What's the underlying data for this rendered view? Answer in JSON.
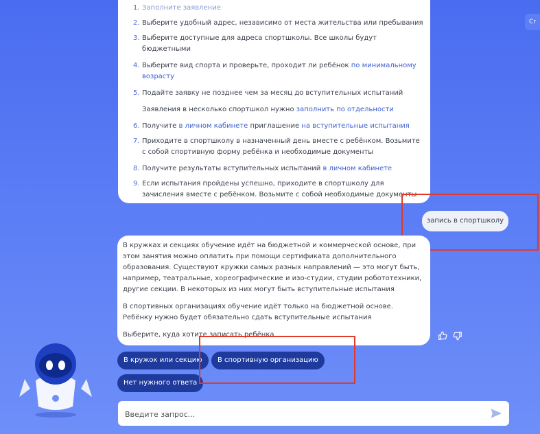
{
  "instructions": {
    "step1_partial": "Заполните заявление",
    "steps": [
      {
        "num": "2.",
        "text": "Выберите удобный адрес, независимо от места жительства или пребывания"
      },
      {
        "num": "3.",
        "text": "Выберите доступные для адреса спортшколы. Все школы будут бюджетными"
      },
      {
        "num": "4.",
        "text_before": "Выберите вид спорта и проверьте, проходит ли ребёнок ",
        "link": "по минимальному возрасту"
      },
      {
        "num": "5.",
        "text": "Подайте заявку не позднее чем за месяц до вступительных испытаний"
      },
      {
        "num": "",
        "text_before": "Заявления в несколько спортшкол нужно ",
        "link": "заполнить по отдельности"
      },
      {
        "num": "6.",
        "text_before": "Получите ",
        "link": "в личном кабинете",
        "text_middle": " приглашение ",
        "link2": "на вступительные испытания"
      },
      {
        "num": "7.",
        "text": "Приходите в спортшколу в назначенный день вместе с ребёнком. Возьмите с собой спортивную форму ребёнка и необходимые документы"
      },
      {
        "num": "8.",
        "text_before": "Получите результаты вступительных испытаний ",
        "link": "в личном кабинете"
      },
      {
        "num": "9.",
        "text": "Если испытания пройдены успешно, приходите в спортшколу для зачисления вместе с ребёнком. Возьмите с собой необходимые документы"
      }
    ]
  },
  "top_right_chip": "Cr",
  "user_message": "запись в спортшколу",
  "bot_message": {
    "p1": "В кружках и секциях обучение идёт на бюджетной и коммерческой основе, при этом занятия можно оплатить при помощи сертификата дополнительного образования. Существуют кружки самых разных направлений — это могут быть, например, театральные, хореографические и изо-студии, студии робототехники, другие секции. В некоторых из них могут быть вступительные испытания",
    "p2": "В спортивных организациях обучение идёт только на бюджетной основе. Ребёнку нужно будет обязательно сдать вступительные испытания",
    "p3": "Выберите, куда хотите записать ребёнка"
  },
  "options": {
    "club": "В кружок или секцию",
    "sport_org": "В спортивную организацию",
    "none": "Нет нужного ответа"
  },
  "input": {
    "placeholder": "Введите запрос..."
  },
  "icons": {
    "like": "thumbs-up-icon",
    "dislike": "thumbs-down-icon",
    "send": "send-arrow-icon",
    "mascot": "robot-mascot"
  },
  "colors": {
    "background": "#4a6cf0",
    "button": "#1d3a9c",
    "link": "#3d5fcf",
    "highlight": "#e03a2a"
  }
}
